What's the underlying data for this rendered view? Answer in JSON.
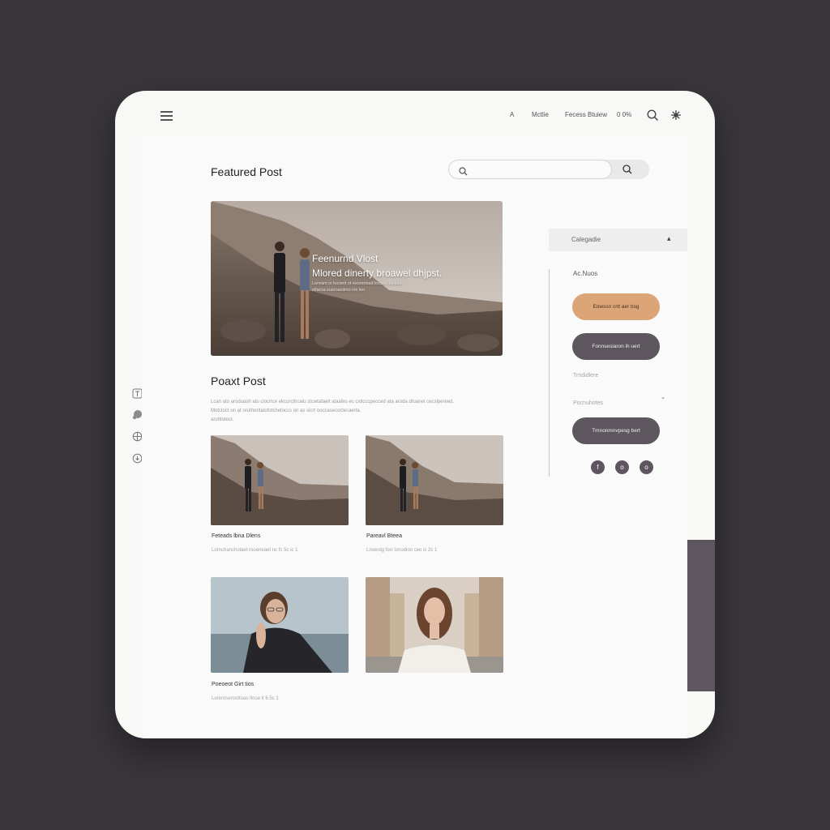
{
  "topbar": {
    "nav_items": [
      "A",
      "Mctlie",
      "Fecess Btuiew",
      "0 0%"
    ]
  },
  "search": {
    "placeholder": ""
  },
  "featured": {
    "title": "Featured Post",
    "hero_headline": "Feenurnd Vlost",
    "hero_subline": "Mlored dinerty broawel dhjpst.",
    "hero_caption_line1": "Loream oi tucsed ot exonomad loosos tucsiot",
    "hero_caption_line2": "ellaroa sueroasiimo ios leo"
  },
  "recent": {
    "title": "Poaxt Post",
    "description": [
      "Lcan ato aroduash ato clocrtce ekcurcthcalo stcwtafaelt ataafes ec cxtlcccpecced ata aroda dtuanet cecslpereed.",
      "Motctoct on at oruthoritatofotchetoccs on as sicrt ooccasecoclecaerta.",
      "aruhtotecr."
    ],
    "posts": [
      {
        "title": "Feteads lbna Dlens",
        "meta": "Lornchancholaet rooeneaet nc fc 5c ic 1"
      },
      {
        "title": "Pareavl Bteea",
        "meta": "Lnoerdg forr lonodioo ceo ic 2c 1"
      },
      {
        "title": "Poeoeot Girt tios",
        "meta": "Loreroseroottoas tloue it 6.5c 1"
      },
      {
        "title": "",
        "meta": ""
      }
    ]
  },
  "sidebar": {
    "category_label": "Calegadie",
    "archives_label": "Ac.Nuos",
    "pill1": "Eowssn crtt aer bsg",
    "pill2": "Fonnsesiaron ih uert",
    "trending_label": "Trndidlere",
    "select_label": "Pocnuhotes",
    "pill3": "Tmnonmnvpesg bert",
    "social": [
      "f",
      "o",
      "o"
    ]
  },
  "colors": {
    "accent_orange": "#dba577",
    "accent_dark": "#5d565e",
    "background": "#38353b",
    "surface": "#f8f8f7"
  }
}
